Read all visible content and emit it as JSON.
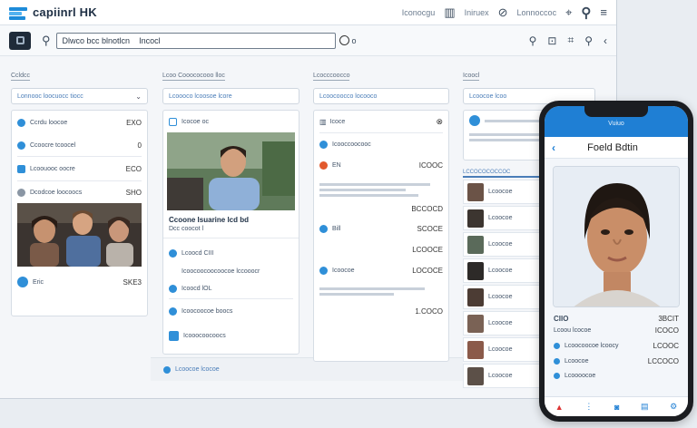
{
  "app": {
    "title": "capiinrl HK"
  },
  "titlebar": {
    "link1": "Iconocgu",
    "link2": "Iniruex",
    "link3": "Lonnoccoc"
  },
  "toolbar": {
    "search_value": "Dlwco bcc blnotlcn    Incocl"
  },
  "columns": [
    {
      "title": "Ccldcc",
      "dropdown": "Lonnooc loocuocc tiocc",
      "rows": [
        {
          "label": "Ccrdu loocoe",
          "value": "EXO"
        },
        {
          "label": "Ccoocre tcoocel",
          "value": "0"
        },
        {
          "label": "Lcoouooc oocre",
          "value": "ECO"
        },
        {
          "label": "Dcodcoe loocoocs",
          "value": "SHO"
        }
      ],
      "footer": {
        "label": "Eric",
        "value": "SKE3"
      }
    },
    {
      "title": "Lcoo Cooococooo lloc",
      "dropdown": "Lcoooco lcoosoe lcore",
      "header": "Icocoe oc",
      "caption": "Ccoone Isuarine lcd bd",
      "caption2": "Dcc coocot l",
      "rows": [
        {
          "label": "Lcoocd CIII"
        },
        {
          "label": "Icoocoocoocoocoe lccooocr"
        },
        {
          "label": "Icoocd lOL"
        },
        {
          "label": "Icoocoocoe boocs"
        },
        {
          "label": "Icooocoocoocs"
        }
      ],
      "footer": "Lcoocoe lcocoe"
    },
    {
      "title": "Lcocccoocco",
      "dropdown": "Lcoocoocco locooco",
      "rows": [
        {
          "label": "Icoce",
          "value": ""
        },
        {
          "label": "Icooccoocooc",
          "value": ""
        },
        {
          "label": "EN",
          "value": "ICOOC"
        },
        {
          "label": "",
          "value": "BCCOCD"
        },
        {
          "label": "Bill",
          "value": "SCOCE"
        },
        {
          "label": "",
          "value": "LCOOCE"
        },
        {
          "label": "Icoocoe",
          "value": "LOCOCE"
        },
        {
          "label": "",
          "value": "1.COCO"
        }
      ]
    },
    {
      "title": "Icoocl",
      "dropdown": "Lcoocoe lcoo",
      "list_header": "LCCOCOCOCCOC",
      "items": [
        "Lcoocoe",
        "Lcoocoe",
        "Lcoocoe",
        "Lcoocoe",
        "Lcoocoe",
        "Lcoocoe",
        "Lcoocoe",
        "Lcoocoe"
      ]
    }
  ],
  "phone": {
    "status": "Vuiuo",
    "title": "Foeld Bdtin",
    "field1": {
      "label": "CIIO",
      "value": "3BCIT"
    },
    "field2": {
      "label": "Lcoou lcocoe",
      "value": "ICOCO"
    },
    "rows": [
      {
        "label": "Lcoocoocoe lcoocy",
        "value": "LCOOC"
      },
      {
        "label": "Lcoocoe",
        "value": "LCCOCO"
      },
      {
        "label": "Lcoooocoe",
        "value": ""
      }
    ]
  },
  "colors": {
    "accent": "#1f7fd4",
    "panel": "#ffffff",
    "bg": "#f4f6f9"
  }
}
